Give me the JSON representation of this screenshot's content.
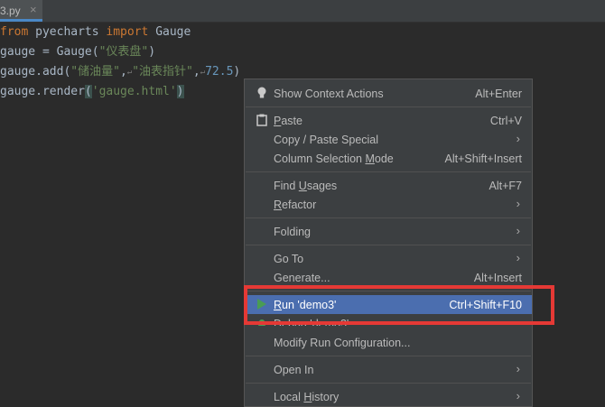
{
  "tab": {
    "filename": "3.py",
    "close_glyph": "×"
  },
  "code": {
    "l1": {
      "kw1": "from",
      "mid": " pyecharts ",
      "kw2": "import",
      "end": " Gauge"
    },
    "l2": {
      "pre": "gauge = Gauge(",
      "str": "\"仪表盘\"",
      "post": ")"
    },
    "l3": {
      "pre": "gauge.add(",
      "s1": "\"储油量\"",
      "c1": ",",
      "s2": "\"油表指针\"",
      "c2": ",",
      "num": "72.5",
      "post": ")"
    },
    "l4": {
      "pre": "gauge.render",
      "open": "(",
      "str": "'gauge.html'",
      "close": ")"
    }
  },
  "context_menu": {
    "show_context_actions": {
      "label": "Show Context Actions",
      "shortcut": "Alt+Enter"
    },
    "paste": {
      "label_u": "P",
      "label_rest": "aste",
      "shortcut": "Ctrl+V"
    },
    "copy_paste_special": {
      "label": "Copy / Paste Special"
    },
    "column_selection": {
      "label_pre": "Column Selection ",
      "label_u": "M",
      "label_rest": "ode",
      "shortcut": "Alt+Shift+Insert"
    },
    "find_usages": {
      "label_pre": "Find ",
      "label_u": "U",
      "label_rest": "sages",
      "shortcut": "Alt+F7"
    },
    "refactor": {
      "label_u": "R",
      "label_rest": "efactor"
    },
    "folding": {
      "label": "Folding"
    },
    "go_to": {
      "label": "Go To"
    },
    "generate": {
      "label": "Generate...",
      "shortcut": "Alt+Insert"
    },
    "run": {
      "label_u": "R",
      "label_rest": "un 'demo3'",
      "shortcut": "Ctrl+Shift+F10"
    },
    "debug": {
      "label": "Debug 'demo3'"
    },
    "modify_run": {
      "label": "Modify Run Configuration..."
    },
    "open_in": {
      "label": "Open In"
    },
    "local_history": {
      "label_pre": "Local ",
      "label_u": "H",
      "label_rest": "istory"
    }
  },
  "colors": {
    "highlight_box": "#e53935",
    "selection": "#4b6eaf",
    "run_icon": "#499c54"
  }
}
